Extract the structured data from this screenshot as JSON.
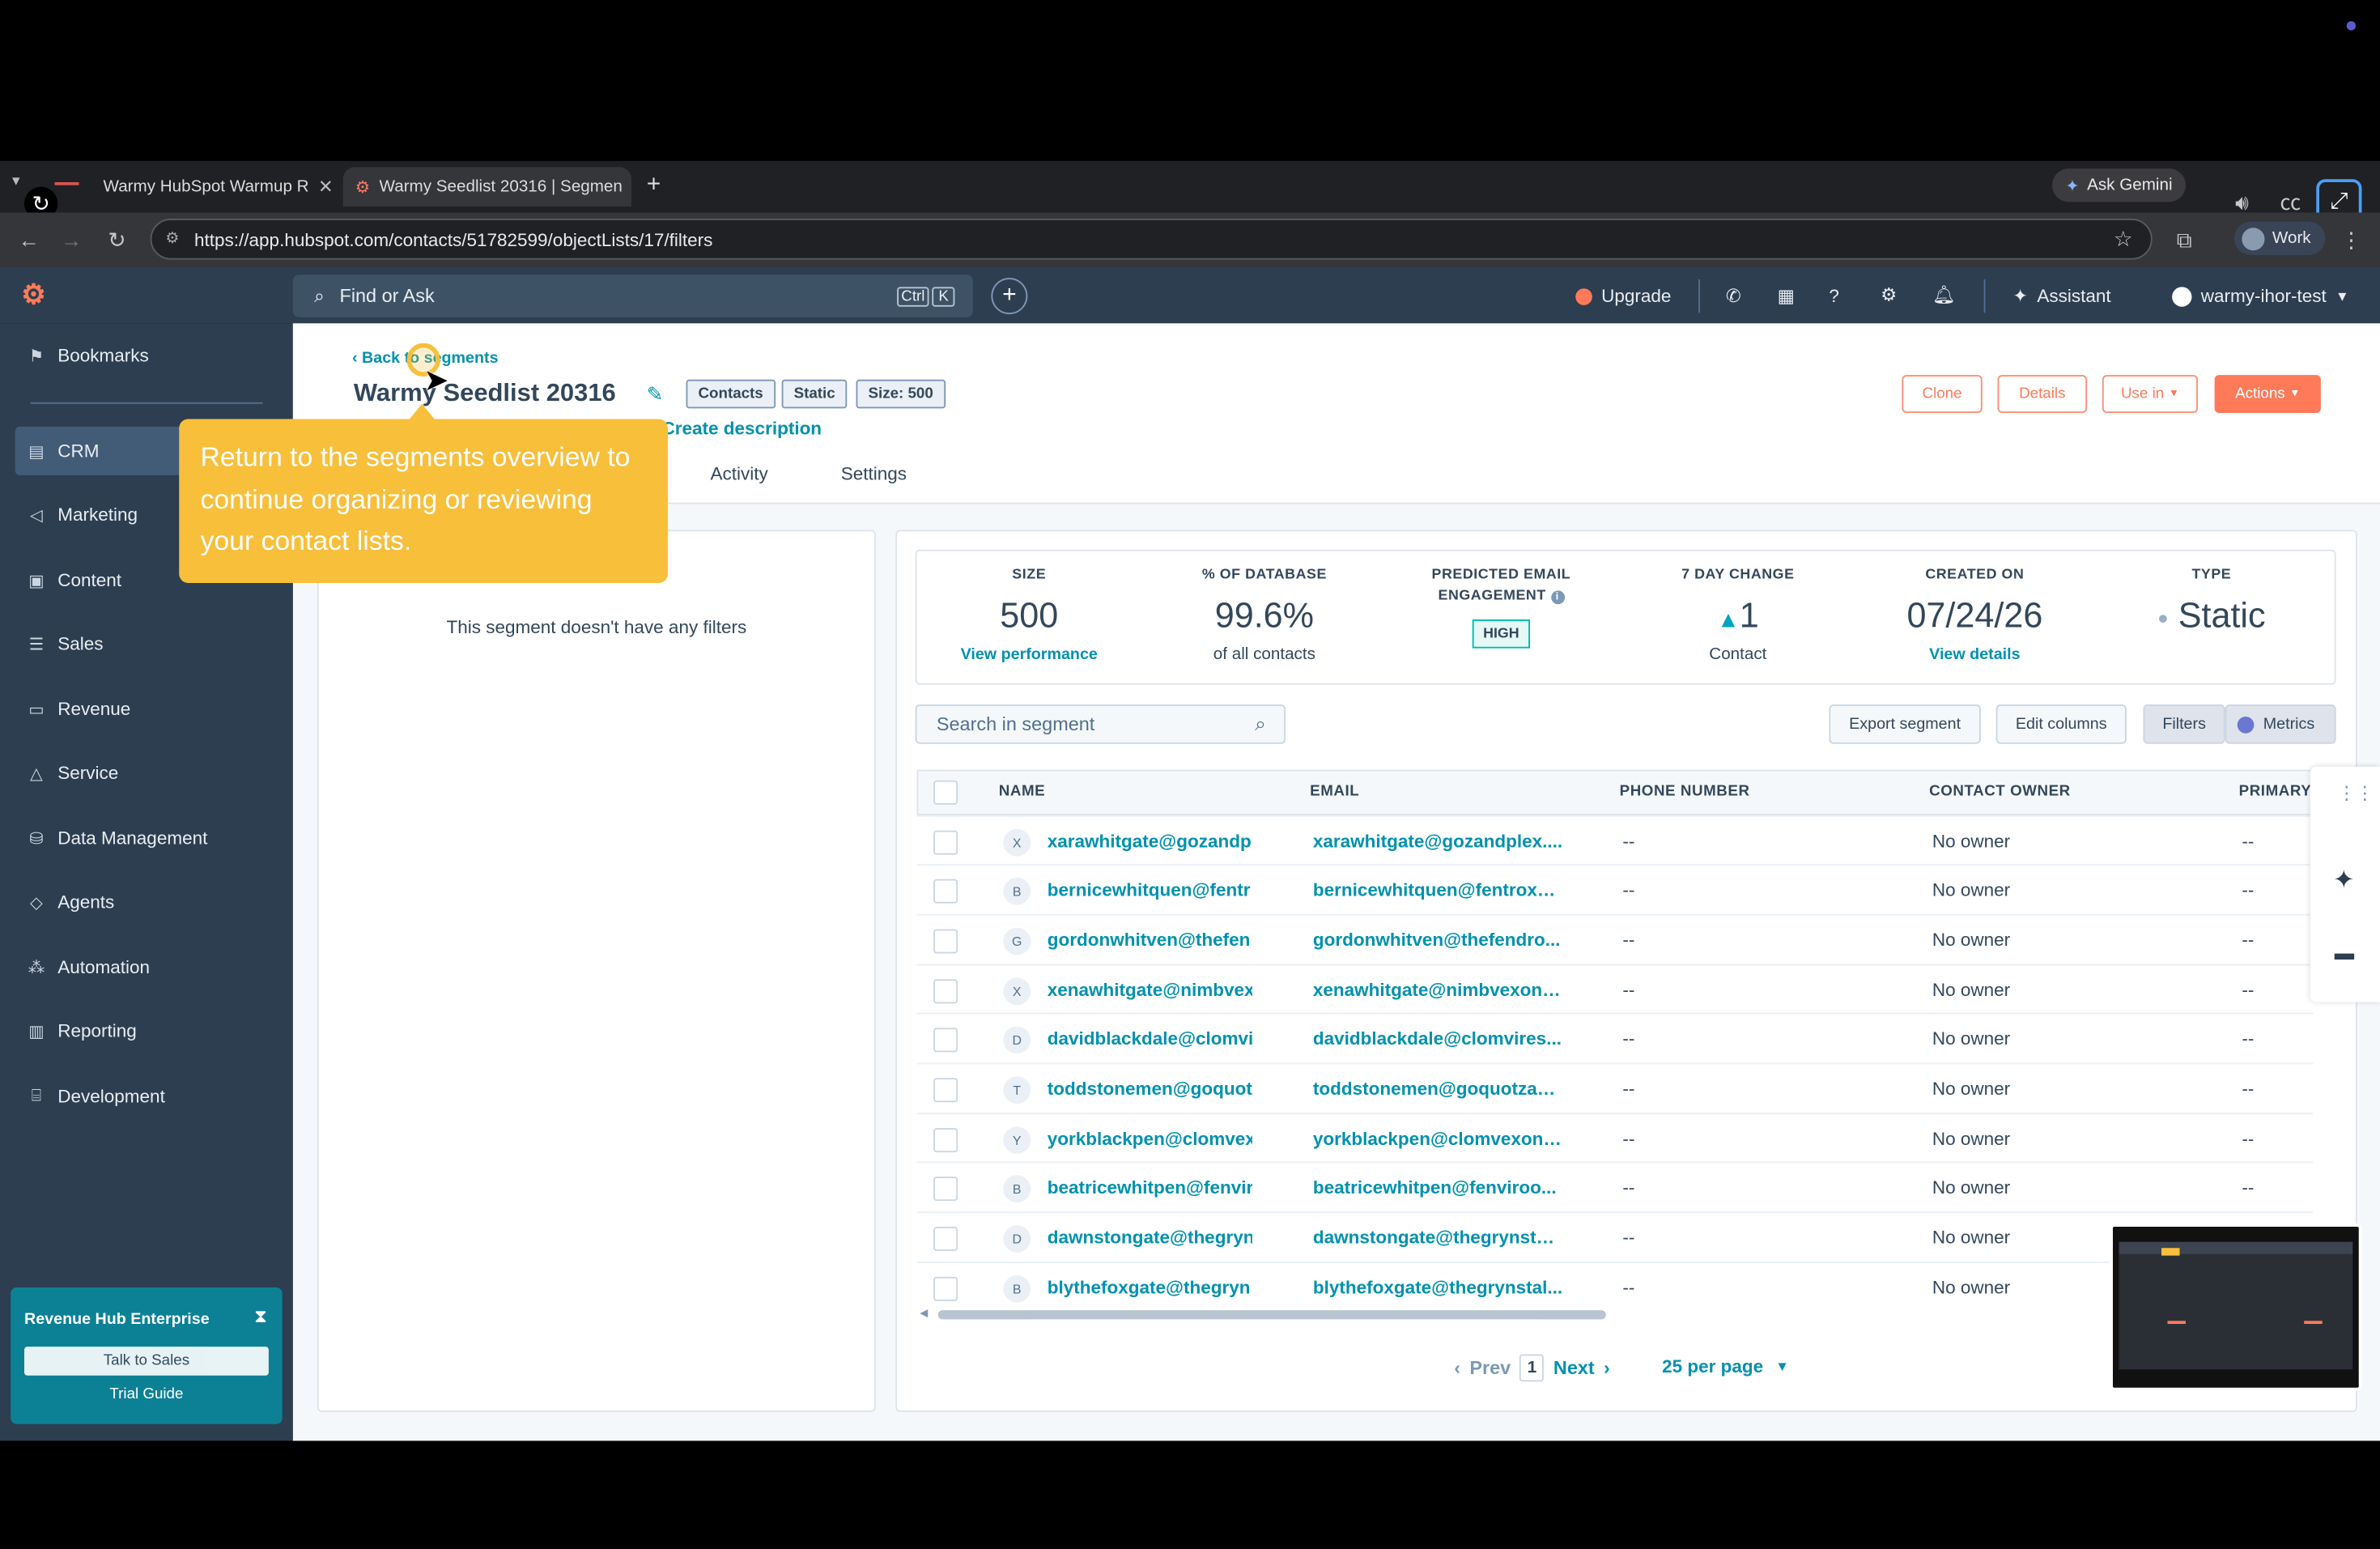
{
  "browser": {
    "tabs": [
      {
        "title": "Warmy HubSpot Warmup R",
        "active": false
      },
      {
        "title": "Warmy Seedlist 20316 | Segmen",
        "active": true
      }
    ],
    "url": "https://app.hubspot.com/contacts/51782599/objectLists/17/filters",
    "ask_gemini": "Ask Gemini",
    "profile": "Work"
  },
  "topnav": {
    "search_placeholder": "Find or Ask",
    "shortcut_ctrl": "Ctrl",
    "shortcut_k": "K",
    "upgrade": "Upgrade",
    "assistant": "Assistant",
    "account": "warmy-ihor-test"
  },
  "sidebar": {
    "bookmarks": "Bookmarks",
    "items": [
      "CRM",
      "Marketing",
      "Content",
      "Sales",
      "Revenue",
      "Service",
      "Data Management",
      "Agents",
      "Automation",
      "Reporting",
      "Development"
    ],
    "promo": {
      "title": "Revenue Hub Enterprise",
      "button": "Talk to Sales",
      "link": "Trial Guide"
    }
  },
  "segment": {
    "back_link": "Back to segments",
    "title": "Warmy Seedlist 20316",
    "tags": [
      "Contacts",
      "Static",
      "Size: 500"
    ],
    "create_description": "Create description",
    "tabs": [
      "Activity",
      "Settings"
    ],
    "actions": {
      "clone": "Clone",
      "details": "Details",
      "use_in": "Use in",
      "actions": "Actions"
    }
  },
  "filters_panel": {
    "empty_text": "This segment doesn't have any filters"
  },
  "stats": {
    "size": {
      "label": "SIZE",
      "value": "500",
      "link": "View performance"
    },
    "database": {
      "label": "% OF DATABASE",
      "value": "99.6%",
      "sub": "of all contacts"
    },
    "engagement": {
      "label_line1": "PREDICTED EMAIL",
      "label_line2": "ENGAGEMENT",
      "badge": "HIGH"
    },
    "change": {
      "label": "7 DAY CHANGE",
      "value": "1",
      "sub": "Contact"
    },
    "created": {
      "label": "CREATED ON",
      "value": "07/24/26",
      "link": "View details"
    },
    "type": {
      "label": "TYPE",
      "value": "Static"
    }
  },
  "table": {
    "search_placeholder": "Search in segment",
    "export": "Export segment",
    "edit_columns": "Edit columns",
    "toggle_filters": "Filters",
    "toggle_metrics": "Metrics",
    "columns": [
      "NAME",
      "EMAIL",
      "PHONE NUMBER",
      "CONTACT OWNER",
      "PRIMARY"
    ],
    "rows": [
      {
        "initial": "X",
        "name": "xarawhitgate@gozandpl",
        "email": "xarawhitgate@gozandplex....",
        "phone": "--",
        "owner": "No owner",
        "primary": "--"
      },
      {
        "initial": "B",
        "name": "bernicewhitquen@fentr",
        "email": "bernicewhitquen@fentroxd...",
        "phone": "--",
        "owner": "No owner",
        "primary": "--"
      },
      {
        "initial": "G",
        "name": "gordonwhitven@thefen",
        "email": "gordonwhitven@thefendro...",
        "phone": "--",
        "owner": "No owner",
        "primary": "--"
      },
      {
        "initial": "X",
        "name": "xenawhitgate@nimbvex",
        "email": "xenawhitgate@nimbvexonli...",
        "phone": "--",
        "owner": "No owner",
        "primary": "--"
      },
      {
        "initial": "D",
        "name": "davidblackdale@clomvi",
        "email": "davidblackdale@clomvires...",
        "phone": "--",
        "owner": "No owner",
        "primary": "--"
      },
      {
        "initial": "T",
        "name": "toddstonemen@goquot",
        "email": "toddstonemen@goquotzan...",
        "phone": "--",
        "owner": "No owner",
        "primary": "--"
      },
      {
        "initial": "Y",
        "name": "yorkblackpen@clomvex",
        "email": "yorkblackpen@clomvexonli...",
        "phone": "--",
        "owner": "No owner",
        "primary": "--"
      },
      {
        "initial": "B",
        "name": "beatricewhitpen@fenvir",
        "email": "beatricewhitpen@fenviroo...",
        "phone": "--",
        "owner": "No owner",
        "primary": "--"
      },
      {
        "initial": "D",
        "name": "dawnstongate@thegryn",
        "email": "dawnstongate@thegrynstal...",
        "phone": "--",
        "owner": "No owner",
        "primary": ""
      },
      {
        "initial": "B",
        "name": "blythefoxgate@thegryn",
        "email": "blythefoxgate@thegrynstal...",
        "phone": "--",
        "owner": "No owner",
        "primary": ""
      }
    ],
    "pagination": {
      "prev": "Prev",
      "page": "1",
      "next": "Next",
      "per_page": "25 per page"
    }
  },
  "tooltip": {
    "text": "Return to the segments overview to continue organizing or reviewing your contact lists."
  },
  "colors": {
    "hubspot_navy": "#2d3e50",
    "accent_orange": "#ff7a59",
    "link_teal": "#0091ae",
    "tooltip_yellow": "#f8bf3b"
  }
}
